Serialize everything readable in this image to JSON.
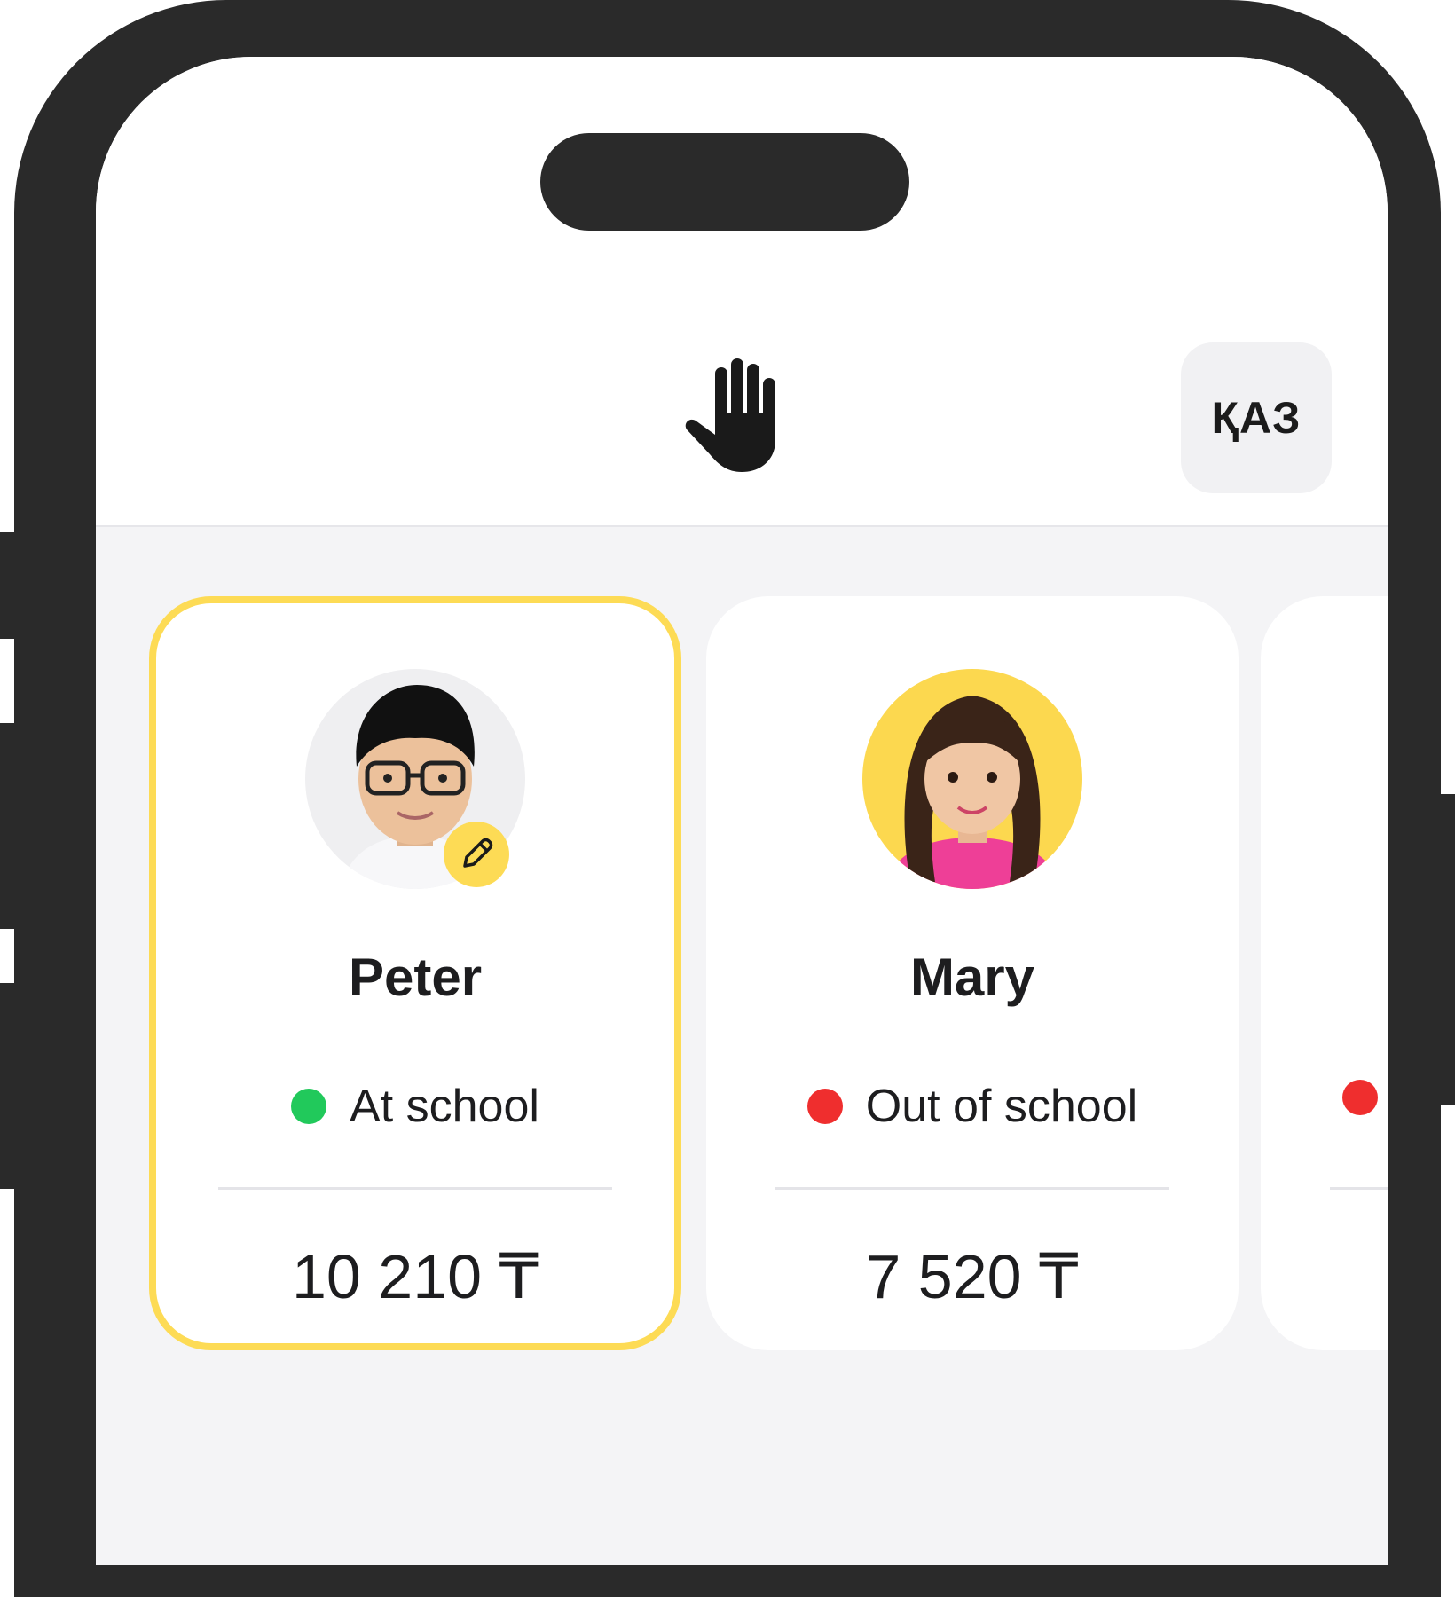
{
  "header": {
    "logo_icon": "raised-hand-icon",
    "lang_button_label": "ҚАЗ"
  },
  "children": [
    {
      "name": "Peter",
      "status": "At school",
      "status_color": "#21c95b",
      "balance": "10 210 ₸",
      "selected": true,
      "edit_icon": "pencil-icon"
    },
    {
      "name": "Mary",
      "status": "Out of school",
      "status_color": "#ef2e2e",
      "balance": "7 520 ₸",
      "selected": false
    },
    {
      "name": "",
      "status": "",
      "status_color": "#ef2e2e",
      "balance": "",
      "selected": false
    }
  ],
  "colors": {
    "accent": "#fddb55",
    "frame": "#2a2a2a",
    "screen_bg": "#f4f4f6"
  }
}
